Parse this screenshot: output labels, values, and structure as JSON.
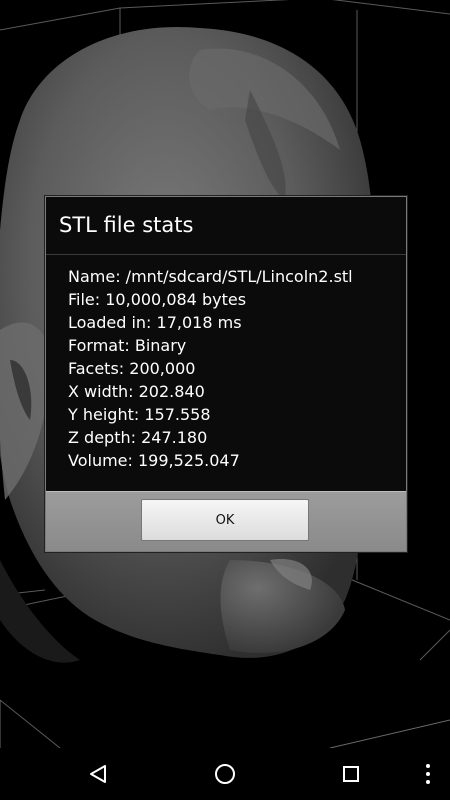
{
  "dialog": {
    "title": "STL file stats",
    "stats": [
      "Name: /mnt/sdcard/STL/Lincoln2.stl",
      "File: 10,000,084 bytes",
      "Loaded in: 17,018 ms",
      "Format: Binary",
      "Facets: 200,000",
      "X width: 202.840",
      "Y height: 157.558",
      "Z depth: 247.180",
      "Volume: 199,525.047"
    ],
    "ok_label": "OK"
  },
  "navbar": {
    "back_icon": "back-triangle-icon",
    "home_icon": "home-circle-icon",
    "recents_icon": "recents-square-icon",
    "overflow_icon": "overflow-menu-icon"
  },
  "colors": {
    "background": "#000000",
    "dialog_bg": "#0b0b0b",
    "button_bar": "#9a9a9a",
    "button": "#eeeeee",
    "model": "#5a5a5a"
  }
}
